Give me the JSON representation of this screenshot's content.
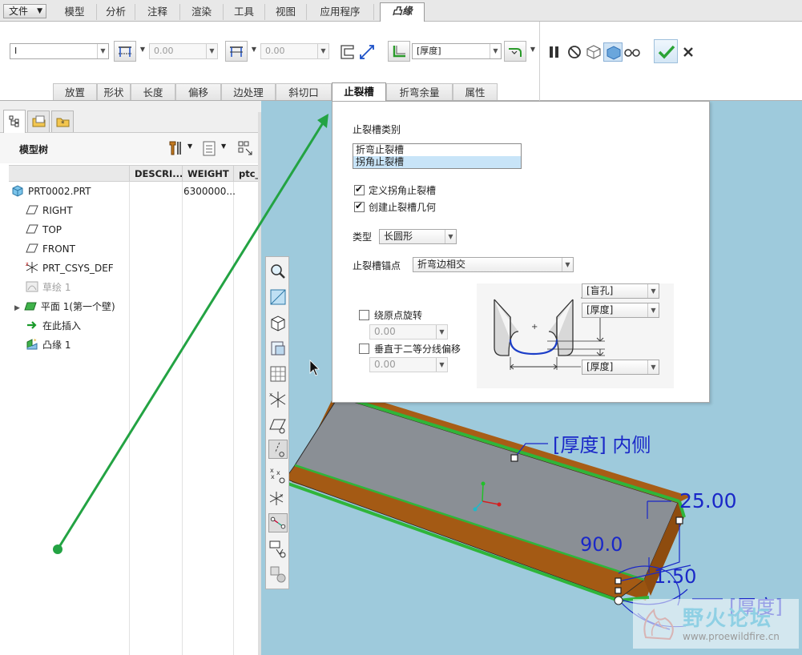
{
  "menubar": {
    "file_label": "文件",
    "tabs": [
      "模型",
      "分析",
      "注释",
      "渲染",
      "工具",
      "视图",
      "应用程序"
    ],
    "active_tab": "凸缘"
  },
  "ribbon": {
    "shape_value": "I",
    "length_value": "0.00",
    "offset_value": "0.00",
    "thickness_value": "[厚度]",
    "subtabs": [
      "放置",
      "形状",
      "长度",
      "偏移",
      "边处理",
      "斜切口",
      "止裂槽",
      "折弯余量",
      "属性"
    ],
    "active_subtab": "止裂槽"
  },
  "model_tree": {
    "title": "模型树",
    "columns": [
      "DESCRI...",
      "WEIGHT",
      "ptc_"
    ],
    "items": [
      {
        "label": "PRT0002.PRT",
        "weight": "6300000...",
        "icon": "part-icon"
      },
      {
        "label": "RIGHT",
        "icon": "datum-plane-icon"
      },
      {
        "label": "TOP",
        "icon": "datum-plane-icon"
      },
      {
        "label": "FRONT",
        "icon": "datum-plane-icon"
      },
      {
        "label": "PRT_CSYS_DEF",
        "icon": "csys-icon"
      },
      {
        "label": "草绘 1",
        "icon": "sketch-icon"
      },
      {
        "label": "平面 1(第一个壁)",
        "icon": "planar-wall-icon"
      },
      {
        "label": "在此插入",
        "icon": "insert-here-icon"
      },
      {
        "label": "凸缘 1",
        "icon": "flange-icon"
      }
    ]
  },
  "relief_panel": {
    "relief_type_label": "止裂槽类别",
    "relief_types": [
      "折弯止裂槽",
      "拐角止裂槽"
    ],
    "selected_relief_type": "拐角止裂槽",
    "define_corner_relief": "定义拐角止裂槽",
    "create_relief_geometry": "创建止裂槽几何",
    "type_label": "类型",
    "type_value": "长圆形",
    "anchor_label": "止裂槽锚点",
    "anchor_value": "折弯边相交",
    "rotate_about_origin": "绕原点旋转",
    "rotate_value": "0.00",
    "offset_normal_bisector": "垂直于二等分线偏移",
    "offset_value": "0.00",
    "diagram_depth": "[盲孔]",
    "diagram_width1": "[厚度]",
    "diagram_width2": "[厚度]"
  },
  "graphics": {
    "label_thickness_inside": "[厚度] 内侧",
    "dim_length": "25.00",
    "dim_angle": "90.0",
    "dim_small": "1.50",
    "label_thickness": "[厚度]"
  },
  "watermark": {
    "title": "野火论坛",
    "url": "www.proewildfire.cn"
  },
  "colors": {
    "graphics_bg": "#9ecadc",
    "wall_top": "#8b9096",
    "wall_side": "#a45a14",
    "edge_green": "#2fb53a",
    "dim_blue": "#1a28c8",
    "arrow_green": "#23a343"
  }
}
